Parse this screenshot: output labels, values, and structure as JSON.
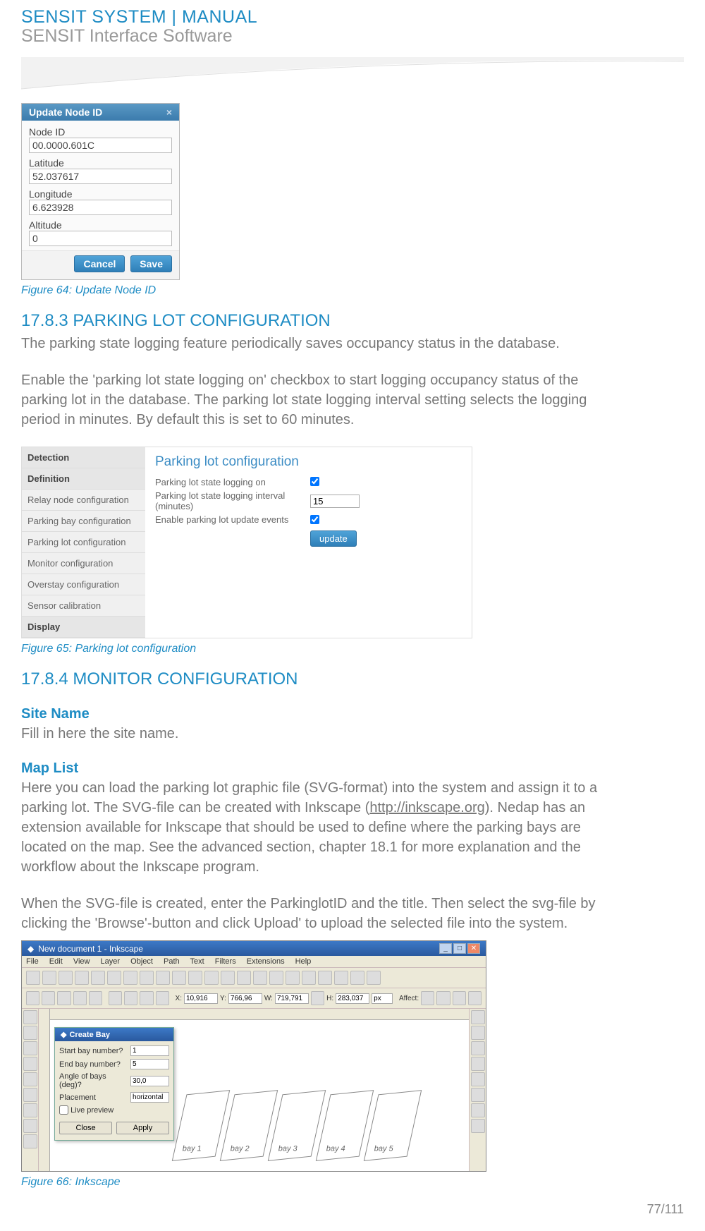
{
  "header": {
    "title": "SENSIT SYSTEM | MANUAL",
    "subtitle": "SENSIT Interface Software"
  },
  "dialog1": {
    "title": "Update Node ID",
    "close": "×",
    "fields": {
      "nodeid_label": "Node ID",
      "nodeid_value": "00.0000.601C",
      "lat_label": "Latitude",
      "lat_value": "52.037617",
      "lon_label": "Longitude",
      "lon_value": "6.623928",
      "alt_label": "Altitude",
      "alt_value": "0"
    },
    "cancel": "Cancel",
    "save": "Save"
  },
  "caption1": "Figure 64: Update Node ID",
  "section1": {
    "heading": "17.8.3 PARKING LOT CONFIGURATION",
    "p1": "The parking state logging feature periodically saves occupancy status in the database.",
    "p2": "Enable the 'parking lot state logging on' checkbox to start logging occupancy status of the parking lot in the database. The parking lot state logging interval setting selects the logging period in minutes. By default this is set to 60 minutes."
  },
  "config": {
    "sidebar": [
      "Detection",
      "Definition",
      "Relay node configuration",
      "Parking bay configuration",
      "Parking lot configuration",
      "Monitor configuration",
      "Overstay configuration",
      "Sensor calibration",
      "Display"
    ],
    "title": "Parking lot configuration",
    "row1": "Parking lot state logging on",
    "row2": "Parking lot state logging interval (minutes)",
    "row2_val": "15",
    "row3": "Enable parking lot update events",
    "update": "update"
  },
  "caption2": "Figure 65: Parking lot configuration",
  "section2": {
    "heading": "17.8.4 MONITOR CONFIGURATION",
    "sub1": "Site Name",
    "sub1_text": "Fill in here the site name.",
    "sub2": "Map List",
    "sub2_text1a": "Here you can load the parking lot graphic file (SVG-format) into the system and assign it to a parking lot. The SVG-file can be created with Inkscape (",
    "sub2_link": "http://inkscape.org",
    "sub2_text1b": "). Nedap has an extension available for Inkscape that should be used to define where the parking bays are located on the map. See the advanced section, chapter 18.1 for more explanation and the workflow about the Inkscape program.",
    "sub2_text2": "When the SVG-file is created, enter the ParkinglotID and the title. Then select the svg-file by clicking the 'Browse'-button and click Upload' to upload the selected file into the system."
  },
  "inkscape": {
    "title": "New document 1 - Inkscape",
    "menu": [
      "File",
      "Edit",
      "View",
      "Layer",
      "Object",
      "Path",
      "Text",
      "Filters",
      "Extensions",
      "Help"
    ],
    "xlabel": "X:",
    "ylabel": "Y:",
    "wlabel": "W:",
    "hlabel": "H:",
    "xval": "10,916",
    "yval": "766,96",
    "wval": "719,791",
    "hval": "283,037",
    "unit": "px",
    "affect": "Affect:",
    "bay_dialog": {
      "title": "Create Bay",
      "r1": "Start bay number?",
      "r1v": "1",
      "r2": "End bay number?",
      "r2v": "5",
      "r3": "Angle of bays (deg)?",
      "r3v": "30,0",
      "r4": "Placement",
      "r4v": "horizontal",
      "r5": "Live preview",
      "close": "Close",
      "apply": "Apply"
    },
    "bays": [
      "bay 1",
      "bay 2",
      "bay 3",
      "bay 4",
      "bay 5"
    ]
  },
  "caption3": "Figure 66: Inkscape",
  "pagenum": "77/111"
}
